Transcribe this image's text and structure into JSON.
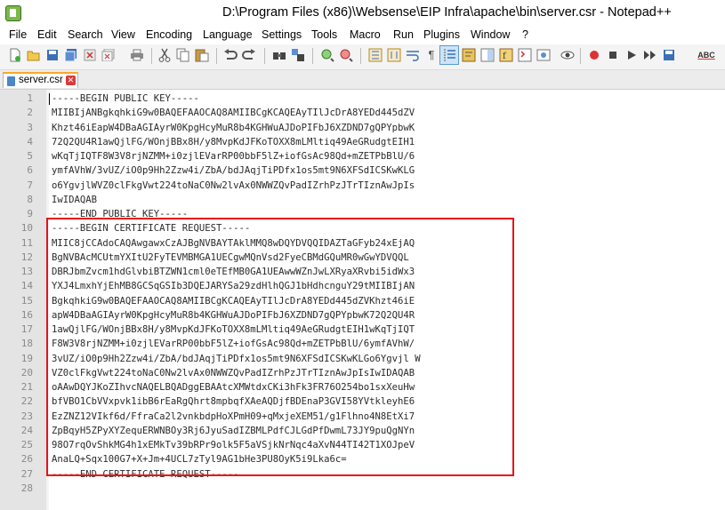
{
  "window": {
    "title": "D:\\Program Files (x86)\\Websense\\EIP Infra\\apache\\bin\\server.csr - Notepad++"
  },
  "menu": {
    "items": [
      "File",
      "Edit",
      "Search",
      "View",
      "Encoding",
      "Language",
      "Settings",
      "Tools",
      "Macro",
      "Run",
      "Plugins",
      "Window",
      "?"
    ]
  },
  "toolbar": {
    "buttons": [
      "new-file-icon",
      "open-file-icon",
      "save-icon",
      "save-all-icon",
      "close-icon",
      "close-all-icon",
      "print-icon",
      "cut-icon",
      "copy-icon",
      "paste-icon",
      "undo-icon",
      "redo-icon",
      "find-icon",
      "replace-icon",
      "zoom-in-icon",
      "zoom-out-icon",
      "sync-vertical-icon",
      "sync-horizontal-icon",
      "word-wrap-icon",
      "show-all-characters-icon",
      "indent-guide-icon",
      "user-language-icon",
      "document-map-icon",
      "function-list-icon",
      "folder-workspace-icon",
      "monitoring-icon",
      "record-macro-icon",
      "stop-recording-icon",
      "playback-icon",
      "run-macro-multiple-icon",
      "save-macro-icon",
      "spell-check-icon"
    ],
    "spellcheck_label": "ABC"
  },
  "tab": {
    "label": "server.csr",
    "close_symbol": "✕"
  },
  "editor": {
    "lines": [
      "-----BEGIN PUBLIC KEY-----",
      "MIIBIjANBgkqhkiG9w0BAQEFAAOCAQ8AMIIBCgKCAQEAyTIlJcDrA8YEDd445dZV",
      "Khzt46iEapW4DBaAGIAyrW0KpgHcyMuR8b4KGHWuAJDoPIFbJ6XZDND7gQPYpbwK",
      "72Q2QU4R1awQjlFG/WOnjBBx8H/y8MvpKdJFKoTOXX8mLMltiq49AeGRudgtEIH1",
      "wKqTjIQTF8W3V8rjNZMM+i0zjlEVarRP00bbF5lZ+iofGsAc98Qd+mZETPbBlU/6",
      "ymfAVhW/3vUZ/iO0p9Hh2Zzw4i/ZbA/bdJAqjTiPDfx1os5mt9N6XFSdICSKwKLG",
      "o6YgvjlWVZ0clFkgVwt224toNaC0Nw2lvAx0NWWZQvPadIZrhPzJTrTIznAwJpIs",
      "IwIDAQAB",
      "-----END PUBLIC KEY-----",
      "-----BEGIN CERTIFICATE REQUEST-----",
      "MIIC8jCCAdoCAQAwgawxCzAJBgNVBAYTAklMMQ8wDQYDVQQIDAZTaGFyb24xEjAQ",
      "BgNVBAcMCUtmYXItU2FyTEVMBMGA1UECgwMQnVsd2FyeCBMdGQuMR0wGwYDVQQL",
      "DBRJbmZvcm1hdGlvbiBTZWN1cml0eTEfMB0GA1UEAwwWZnJwLXRyaXRvbi5idWx3",
      "YXJ4LmxhYjEhMB8GCSqGSIb3DQEJARYSa29zdHlhQGJ1bHdhcnguY29tMIIBIjAN",
      "BgkqhkiG9w0BAQEFAAOCAQ8AMIIBCgKCAQEAyTIlJcDrA8YEDd445dZVKhzt46iE",
      "apW4DBaAGIAyrW0KpgHcyMuR8b4KGHWuAJDoPIFbJ6XZDND7gQPYpbwK72Q2QU4R",
      "1awQjlFG/WOnjBBx8H/y8MvpKdJFKoTOXX8mLMltiq49AeGRudgtEIH1wKqTjIQT",
      "F8W3V8rjNZMM+i0zjlEVarRP00bbF5lZ+iofGsAc98Qd+mZETPbBlU/6ymfAVhW/",
      "3vUZ/iO0p9Hh2Zzw4i/ZbA/bdJAqjTiPDfx1os5mt9N6XFSdICSKwKLGo6Ygvjl W",
      "VZ0clFkgVwt224toNaC0Nw2lvAx0NWWZQvPadIZrhPzJTrTIznAwJpIsIwIDAQAB",
      "oAAwDQYJKoZIhvcNAQELBQADggEBAAtcXMWtdxCKi3hFk3FR76O254bo1sxXeuHw",
      "bfVBO1CbVVxpvk1ibB6rEaRgQhrt8mpbqfXAeAQDjfBDEnaP3GVI58YVtkleyhE6",
      "EzZNZ12VIkf6d/FfraCa2l2vnkbdpHoXPmH09+qMxjeXEM51/g1Flhno4N8EtXi7",
      "ZpBqyH5ZPyXYZequERWNBOy3Rj6JyuSadIZBMLPdfCJLGdPfDwmL73JY9puQgNYn",
      "98O7rqOvShkMG4h1xEMkTv39bRPr9olk5F5aVSjkNrNqc4aXvN44TI42T1XOJpeV",
      "AnaLQ+Sqx100G7+X+Jm+4UCL7zTyl9AG1bHe3PU8OyK5i9Lka6c=",
      "-----END CERTIFICATE REQUEST-----",
      ""
    ]
  },
  "colors": {
    "highlight_border": "#e8131a",
    "gutter_bg": "#e4e4e4",
    "tab_accent": "#f7a82b",
    "active_button_bg": "#cde4f7"
  }
}
